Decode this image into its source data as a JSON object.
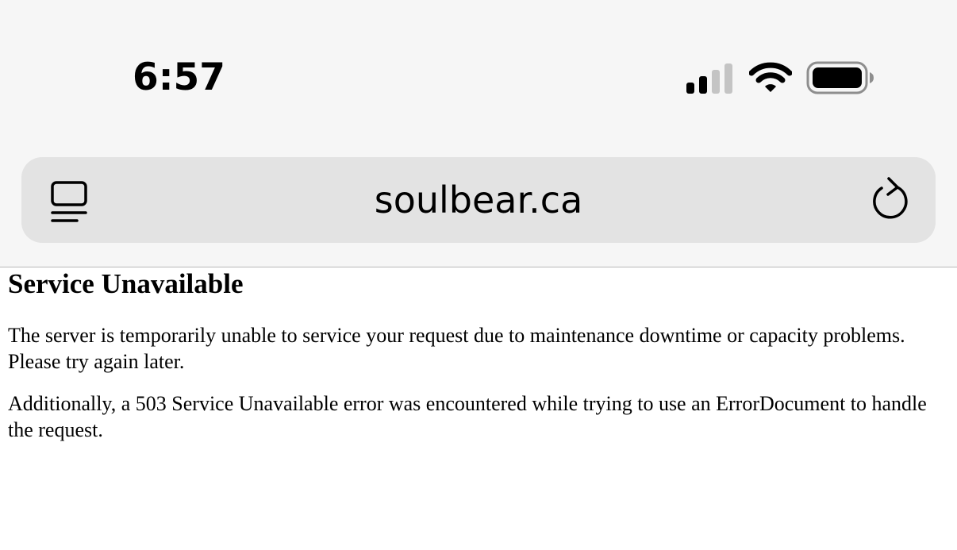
{
  "status_bar": {
    "time": "6:57",
    "icons": [
      "signal-icon",
      "wifi-icon",
      "battery-icon"
    ]
  },
  "address_bar": {
    "url": "soulbear.ca",
    "left_icon": "tabs-icon",
    "right_icon": "reload-icon"
  },
  "page": {
    "title": "Service Unavailable",
    "paragraphs": [
      "The server is temporarily unable to service your request due to maintenance downtime or capacity problems. Please try again later.",
      "Additionally, a 503 Service Unavailable error was encountered while trying to use an ErrorDocument to handle the request."
    ]
  },
  "colors": {
    "chrome_background": "#f6f6f6",
    "address_bar_background": "#e3e3e3",
    "page_background": "#ffffff"
  }
}
